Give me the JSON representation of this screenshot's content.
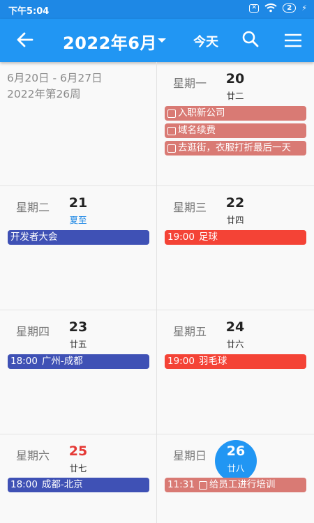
{
  "status": {
    "time": "下午5:04",
    "battery": "2"
  },
  "appbar": {
    "title": "2022年6月",
    "today": "今天"
  },
  "range": {
    "dates": "6月20日 - 6月27日",
    "week": "2022年第26周"
  },
  "days": [
    {
      "weekday": "星期一",
      "date": "20",
      "lunar": "廿二"
    },
    {
      "weekday": "星期二",
      "date": "21",
      "lunar": "夏至"
    },
    {
      "weekday": "星期三",
      "date": "22",
      "lunar": "廿四"
    },
    {
      "weekday": "星期四",
      "date": "23",
      "lunar": "廿五"
    },
    {
      "weekday": "星期五",
      "date": "24",
      "lunar": "廿六"
    },
    {
      "weekday": "星期六",
      "date": "25",
      "lunar": "廿七"
    },
    {
      "weekday": "星期日",
      "date": "26",
      "lunar": "廿八"
    }
  ],
  "events": {
    "mon": [
      {
        "title": "入职新公司",
        "color": "#d97a74"
      },
      {
        "title": "域名续费",
        "color": "#d97a74"
      },
      {
        "title": "去逛街，衣服打折最后一天",
        "color": "#d97a74"
      }
    ],
    "tue": [
      {
        "title": "开发者大会",
        "color": "#3f51b5"
      }
    ],
    "wed": [
      {
        "time": "19:00",
        "title": "足球",
        "color": "#f44336"
      }
    ],
    "thu": [
      {
        "time": "18:00",
        "title": "广州-成都",
        "color": "#3f51b5"
      }
    ],
    "fri": [
      {
        "time": "19:00",
        "title": "羽毛球",
        "color": "#f44336"
      }
    ],
    "sat": [
      {
        "time": "18:00",
        "title": "成都-北京",
        "color": "#3f51b5"
      }
    ],
    "sun": [
      {
        "time": "11:31",
        "title": "给员工进行培训",
        "color": "#d97a74"
      }
    ]
  },
  "colors": {
    "appbar": "#2196f3",
    "statusbar": "#1e88e5",
    "holiday": "#1e88e5",
    "weekend": "#e53935"
  },
  "icons": [
    "back-arrow-icon",
    "dropdown-caret-icon",
    "search-icon",
    "menu-icon",
    "wifi-icon",
    "battery-icon",
    "sim-icon",
    "charging-icon"
  ]
}
